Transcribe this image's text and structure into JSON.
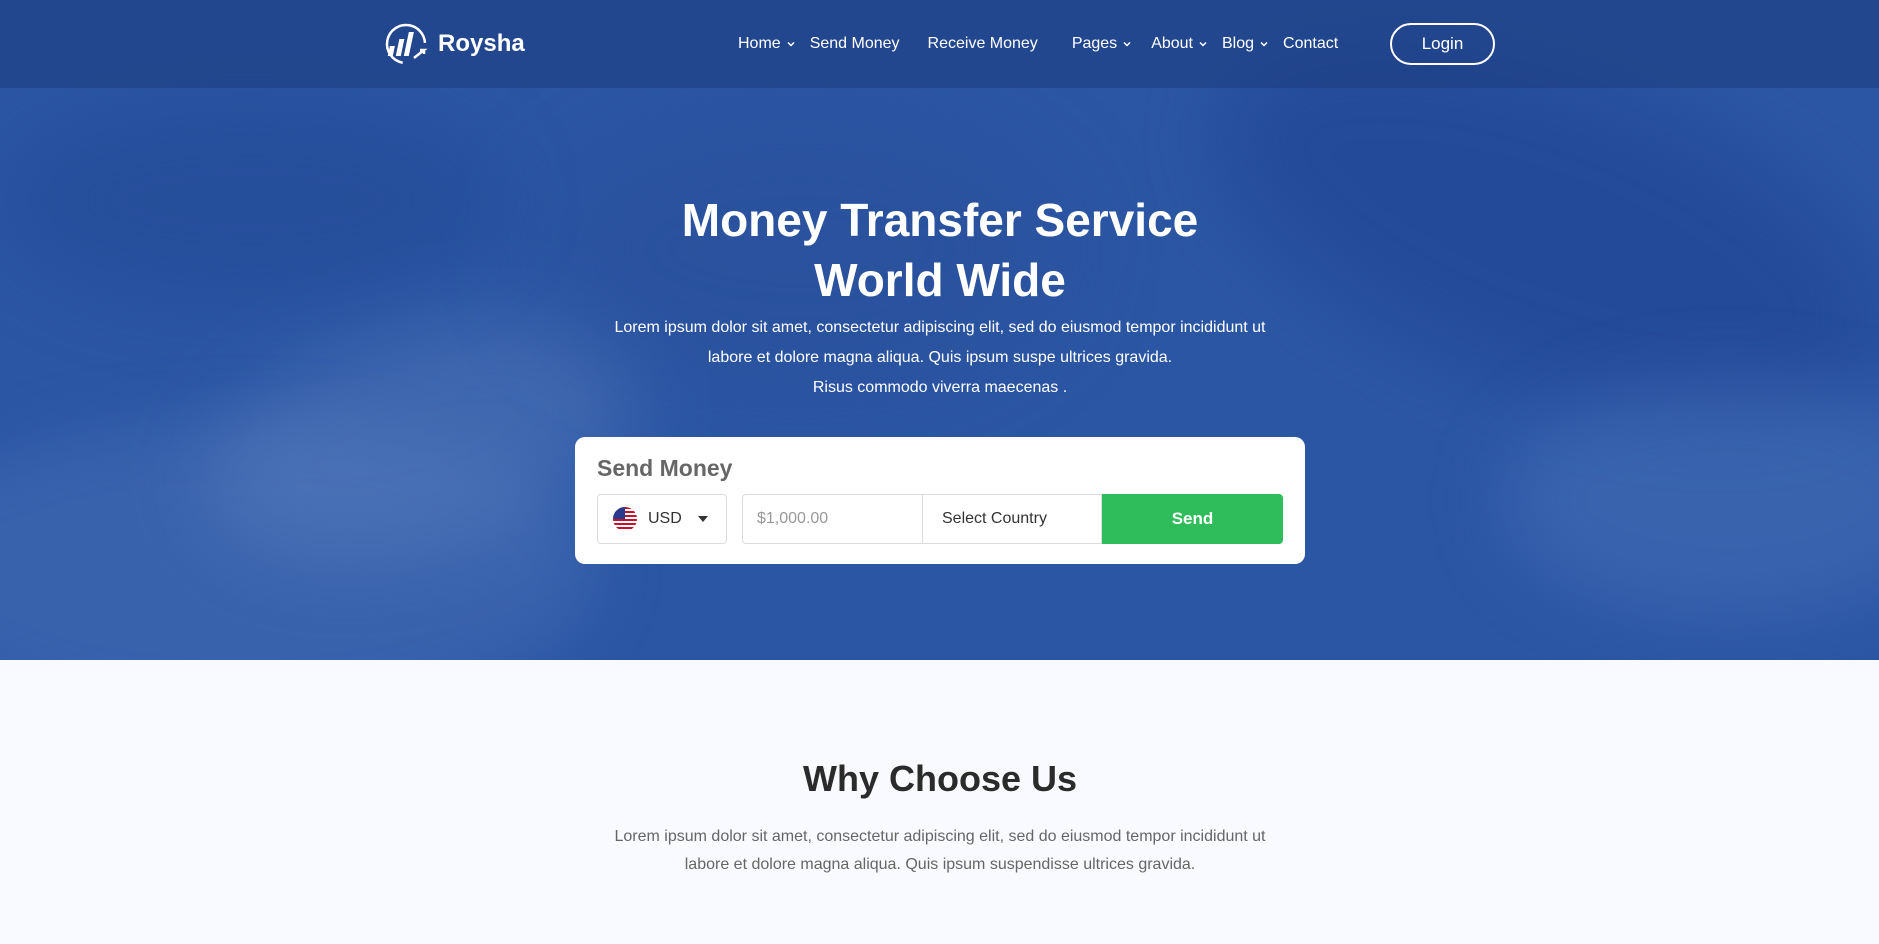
{
  "brand": {
    "name": "Roysha"
  },
  "nav": {
    "items": [
      {
        "label": "Home",
        "dropdown": true
      },
      {
        "label": "Send Money",
        "dropdown": false
      },
      {
        "label": "Receive Money",
        "dropdown": false
      },
      {
        "label": "Pages",
        "dropdown": true
      },
      {
        "label": "About",
        "dropdown": true
      },
      {
        "label": "Blog",
        "dropdown": true
      },
      {
        "label": "Contact",
        "dropdown": false
      }
    ],
    "login_label": "Login"
  },
  "hero": {
    "title_line1": "Money Transfer Service",
    "title_line2": "World Wide",
    "desc_line1": "Lorem ipsum dolor sit amet, consectetur adipiscing elit, sed do eiusmod tempor incididunt ut",
    "desc_line2": "labore et dolore magna aliqua. Quis ipsum suspe ultrices gravida.",
    "desc_line3": "Risus commodo viverra maecenas ."
  },
  "send_money": {
    "title": "Send Money",
    "currency": "USD",
    "amount_placeholder": "$1,000.00",
    "country_label": "Select Country",
    "send_label": "Send"
  },
  "why": {
    "title": "Why Choose Us",
    "desc_line1": "Lorem ipsum dolor sit amet, consectetur adipiscing elit, sed do eiusmod tempor incididunt ut",
    "desc_line2": "labore et dolore magna aliqua. Quis ipsum suspendisse ultrices gravida."
  },
  "colors": {
    "hero_bg": "#2b56a3",
    "send_button": "#2fbd5b",
    "section_bg": "#f8faff"
  }
}
